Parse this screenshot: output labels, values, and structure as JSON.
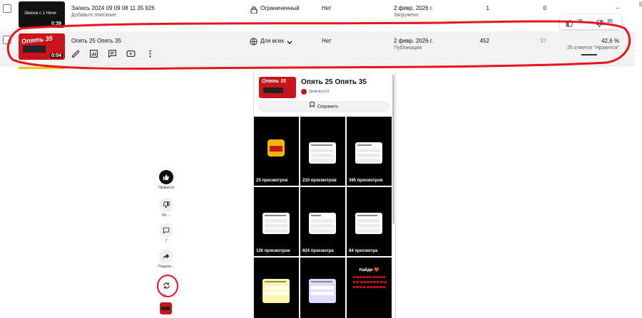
{
  "rows": [
    {
      "thumb_text": "Звонок с 1 Ночи",
      "duration": "0:39",
      "title": "Запись 2024 09 09 08 11 35 926",
      "description": "Добавьте описание",
      "visibility": "Ограниченный",
      "restrictions": "Нет",
      "date": "2 февр. 2026 г.",
      "date_sub": "Загружено",
      "views": "1",
      "comments": "0",
      "likes_pct": "–"
    },
    {
      "thumb_text": "Опять 35",
      "duration": "0:04",
      "title": "Опять 25 Опять 35",
      "visibility": "Для всех",
      "restrictions": "Нет",
      "date": "2 февр. 2026 г.",
      "date_sub": "Публикация",
      "views": "452",
      "comments": "37",
      "likes_pct": "42,6 %",
      "likes_sub": "25 отметок \"Нравится\""
    }
  ],
  "popover": {
    "likes": "26",
    "dislikes": "35"
  },
  "phone": {
    "title": "Опять 25 Опять 35",
    "channel": "@ellisbro3.0",
    "save_label": "Сохранить",
    "thumb_text": "Опять 35",
    "tiles": [
      {
        "caption": "25 просмотров"
      },
      {
        "caption": "210 просмотров"
      },
      {
        "caption": "395 просмотров"
      },
      {
        "caption": "126 просмотров"
      },
      {
        "caption": "824 просмотра"
      },
      {
        "caption": "84 просмотра"
      },
      {
        "caption": ""
      },
      {
        "caption": ""
      },
      {
        "caption": "",
        "heading": "Найди ❤️"
      }
    ]
  },
  "actions": {
    "like": "Нравится",
    "dislike": "Не ...",
    "comments": "7",
    "share": "Подели...",
    "remix": "Ре..."
  },
  "colors": {
    "annotation": "#e8131b",
    "thumb_red": "#c8141b",
    "link_blue": "#3ea6ff"
  }
}
